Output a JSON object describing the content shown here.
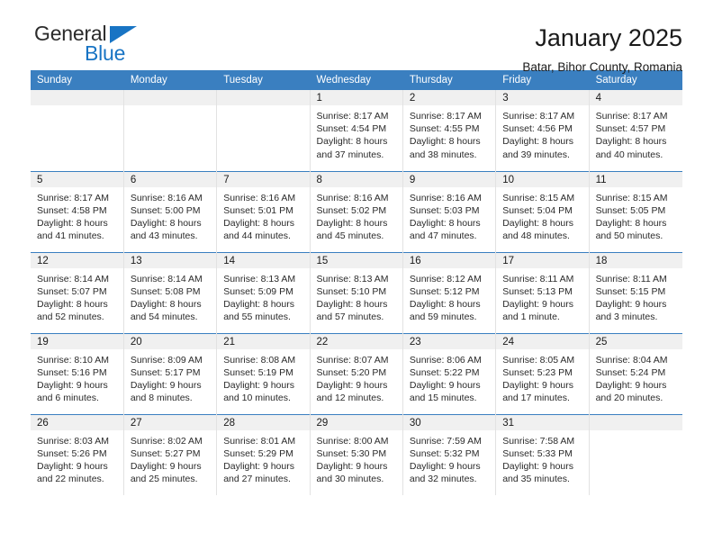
{
  "brand": {
    "name_part1": "General",
    "name_part2": "Blue"
  },
  "header": {
    "title": "January 2025",
    "subtitle": "Batar, Bihor County, Romania"
  },
  "colors": {
    "header_blue": "#3a7fc0",
    "brand_blue": "#1874c4",
    "daynum_band": "#f0f0f0",
    "text": "#1a1a1a"
  },
  "weekdays": [
    "Sunday",
    "Monday",
    "Tuesday",
    "Wednesday",
    "Thursday",
    "Friday",
    "Saturday"
  ],
  "weeks": [
    [
      {
        "day": "",
        "sunrise": "",
        "sunset": "",
        "daylight1": "",
        "daylight2": ""
      },
      {
        "day": "",
        "sunrise": "",
        "sunset": "",
        "daylight1": "",
        "daylight2": ""
      },
      {
        "day": "",
        "sunrise": "",
        "sunset": "",
        "daylight1": "",
        "daylight2": ""
      },
      {
        "day": "1",
        "sunrise": "Sunrise: 8:17 AM",
        "sunset": "Sunset: 4:54 PM",
        "daylight1": "Daylight: 8 hours",
        "daylight2": "and 37 minutes."
      },
      {
        "day": "2",
        "sunrise": "Sunrise: 8:17 AM",
        "sunset": "Sunset: 4:55 PM",
        "daylight1": "Daylight: 8 hours",
        "daylight2": "and 38 minutes."
      },
      {
        "day": "3",
        "sunrise": "Sunrise: 8:17 AM",
        "sunset": "Sunset: 4:56 PM",
        "daylight1": "Daylight: 8 hours",
        "daylight2": "and 39 minutes."
      },
      {
        "day": "4",
        "sunrise": "Sunrise: 8:17 AM",
        "sunset": "Sunset: 4:57 PM",
        "daylight1": "Daylight: 8 hours",
        "daylight2": "and 40 minutes."
      }
    ],
    [
      {
        "day": "5",
        "sunrise": "Sunrise: 8:17 AM",
        "sunset": "Sunset: 4:58 PM",
        "daylight1": "Daylight: 8 hours",
        "daylight2": "and 41 minutes."
      },
      {
        "day": "6",
        "sunrise": "Sunrise: 8:16 AM",
        "sunset": "Sunset: 5:00 PM",
        "daylight1": "Daylight: 8 hours",
        "daylight2": "and 43 minutes."
      },
      {
        "day": "7",
        "sunrise": "Sunrise: 8:16 AM",
        "sunset": "Sunset: 5:01 PM",
        "daylight1": "Daylight: 8 hours",
        "daylight2": "and 44 minutes."
      },
      {
        "day": "8",
        "sunrise": "Sunrise: 8:16 AM",
        "sunset": "Sunset: 5:02 PM",
        "daylight1": "Daylight: 8 hours",
        "daylight2": "and 45 minutes."
      },
      {
        "day": "9",
        "sunrise": "Sunrise: 8:16 AM",
        "sunset": "Sunset: 5:03 PM",
        "daylight1": "Daylight: 8 hours",
        "daylight2": "and 47 minutes."
      },
      {
        "day": "10",
        "sunrise": "Sunrise: 8:15 AM",
        "sunset": "Sunset: 5:04 PM",
        "daylight1": "Daylight: 8 hours",
        "daylight2": "and 48 minutes."
      },
      {
        "day": "11",
        "sunrise": "Sunrise: 8:15 AM",
        "sunset": "Sunset: 5:05 PM",
        "daylight1": "Daylight: 8 hours",
        "daylight2": "and 50 minutes."
      }
    ],
    [
      {
        "day": "12",
        "sunrise": "Sunrise: 8:14 AM",
        "sunset": "Sunset: 5:07 PM",
        "daylight1": "Daylight: 8 hours",
        "daylight2": "and 52 minutes."
      },
      {
        "day": "13",
        "sunrise": "Sunrise: 8:14 AM",
        "sunset": "Sunset: 5:08 PM",
        "daylight1": "Daylight: 8 hours",
        "daylight2": "and 54 minutes."
      },
      {
        "day": "14",
        "sunrise": "Sunrise: 8:13 AM",
        "sunset": "Sunset: 5:09 PM",
        "daylight1": "Daylight: 8 hours",
        "daylight2": "and 55 minutes."
      },
      {
        "day": "15",
        "sunrise": "Sunrise: 8:13 AM",
        "sunset": "Sunset: 5:10 PM",
        "daylight1": "Daylight: 8 hours",
        "daylight2": "and 57 minutes."
      },
      {
        "day": "16",
        "sunrise": "Sunrise: 8:12 AM",
        "sunset": "Sunset: 5:12 PM",
        "daylight1": "Daylight: 8 hours",
        "daylight2": "and 59 minutes."
      },
      {
        "day": "17",
        "sunrise": "Sunrise: 8:11 AM",
        "sunset": "Sunset: 5:13 PM",
        "daylight1": "Daylight: 9 hours",
        "daylight2": "and 1 minute."
      },
      {
        "day": "18",
        "sunrise": "Sunrise: 8:11 AM",
        "sunset": "Sunset: 5:15 PM",
        "daylight1": "Daylight: 9 hours",
        "daylight2": "and 3 minutes."
      }
    ],
    [
      {
        "day": "19",
        "sunrise": "Sunrise: 8:10 AM",
        "sunset": "Sunset: 5:16 PM",
        "daylight1": "Daylight: 9 hours",
        "daylight2": "and 6 minutes."
      },
      {
        "day": "20",
        "sunrise": "Sunrise: 8:09 AM",
        "sunset": "Sunset: 5:17 PM",
        "daylight1": "Daylight: 9 hours",
        "daylight2": "and 8 minutes."
      },
      {
        "day": "21",
        "sunrise": "Sunrise: 8:08 AM",
        "sunset": "Sunset: 5:19 PM",
        "daylight1": "Daylight: 9 hours",
        "daylight2": "and 10 minutes."
      },
      {
        "day": "22",
        "sunrise": "Sunrise: 8:07 AM",
        "sunset": "Sunset: 5:20 PM",
        "daylight1": "Daylight: 9 hours",
        "daylight2": "and 12 minutes."
      },
      {
        "day": "23",
        "sunrise": "Sunrise: 8:06 AM",
        "sunset": "Sunset: 5:22 PM",
        "daylight1": "Daylight: 9 hours",
        "daylight2": "and 15 minutes."
      },
      {
        "day": "24",
        "sunrise": "Sunrise: 8:05 AM",
        "sunset": "Sunset: 5:23 PM",
        "daylight1": "Daylight: 9 hours",
        "daylight2": "and 17 minutes."
      },
      {
        "day": "25",
        "sunrise": "Sunrise: 8:04 AM",
        "sunset": "Sunset: 5:24 PM",
        "daylight1": "Daylight: 9 hours",
        "daylight2": "and 20 minutes."
      }
    ],
    [
      {
        "day": "26",
        "sunrise": "Sunrise: 8:03 AM",
        "sunset": "Sunset: 5:26 PM",
        "daylight1": "Daylight: 9 hours",
        "daylight2": "and 22 minutes."
      },
      {
        "day": "27",
        "sunrise": "Sunrise: 8:02 AM",
        "sunset": "Sunset: 5:27 PM",
        "daylight1": "Daylight: 9 hours",
        "daylight2": "and 25 minutes."
      },
      {
        "day": "28",
        "sunrise": "Sunrise: 8:01 AM",
        "sunset": "Sunset: 5:29 PM",
        "daylight1": "Daylight: 9 hours",
        "daylight2": "and 27 minutes."
      },
      {
        "day": "29",
        "sunrise": "Sunrise: 8:00 AM",
        "sunset": "Sunset: 5:30 PM",
        "daylight1": "Daylight: 9 hours",
        "daylight2": "and 30 minutes."
      },
      {
        "day": "30",
        "sunrise": "Sunrise: 7:59 AM",
        "sunset": "Sunset: 5:32 PM",
        "daylight1": "Daylight: 9 hours",
        "daylight2": "and 32 minutes."
      },
      {
        "day": "31",
        "sunrise": "Sunrise: 7:58 AM",
        "sunset": "Sunset: 5:33 PM",
        "daylight1": "Daylight: 9 hours",
        "daylight2": "and 35 minutes."
      },
      {
        "day": "",
        "sunrise": "",
        "sunset": "",
        "daylight1": "",
        "daylight2": ""
      }
    ]
  ]
}
